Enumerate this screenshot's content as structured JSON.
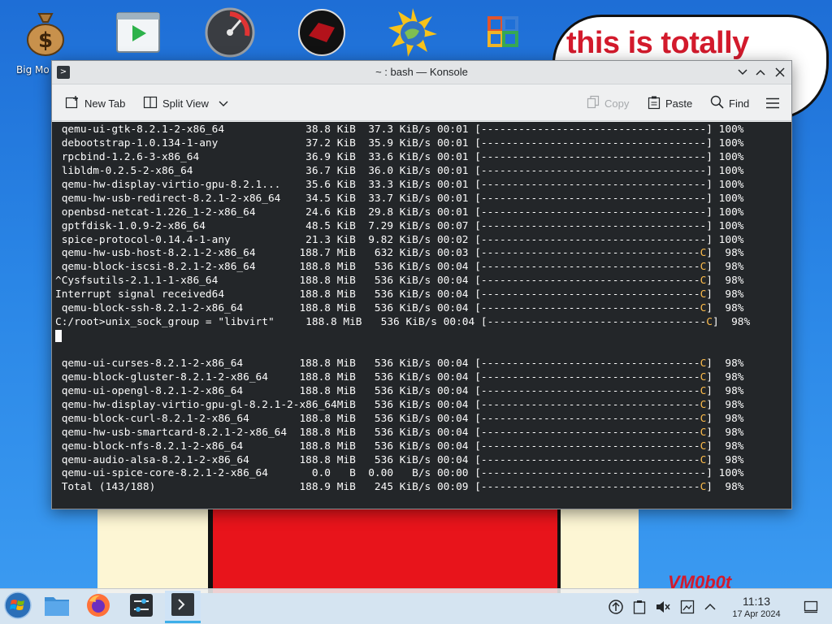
{
  "desktop": {
    "icons": [
      {
        "name": "money-bag-icon",
        "label": "Big Mo Delu"
      },
      {
        "name": "video-player-icon",
        "label": ""
      },
      {
        "name": "speedometer-icon",
        "label": ""
      },
      {
        "name": "red-sphere-icon",
        "label": ""
      },
      {
        "name": "globe-sun-icon",
        "label": ""
      },
      {
        "name": "office-icon",
        "label": ""
      }
    ],
    "wallpaper_text": "this is totally",
    "wallpaper_signature": "VM0b0t"
  },
  "window": {
    "title": "~ : bash — Konsole",
    "toolbar": {
      "new_tab": "New Tab",
      "split_view": "Split View",
      "copy": "Copy",
      "paste": "Paste",
      "find": "Find"
    }
  },
  "terminal": {
    "lines": [
      {
        "t": " qemu-ui-gtk-8.2.1-2-x86_64             38.8 KiB  37.3 KiB/s 00:01 [------------------------------------] 100%"
      },
      {
        "t": " debootstrap-1.0.134-1-any              37.2 KiB  35.9 KiB/s 00:01 [------------------------------------] 100%"
      },
      {
        "t": " rpcbind-1.2.6-3-x86_64                 36.9 KiB  33.6 KiB/s 00:01 [------------------------------------] 100%"
      },
      {
        "t": " libldm-0.2.5-2-x86_64                  36.7 KiB  36.0 KiB/s 00:01 [------------------------------------] 100%"
      },
      {
        "t": " qemu-hw-display-virtio-gpu-8.2.1...    35.6 KiB  33.3 KiB/s 00:01 [------------------------------------] 100%"
      },
      {
        "t": " qemu-hw-usb-redirect-8.2.1-2-x86_64    34.5 KiB  33.7 KiB/s 00:01 [------------------------------------] 100%"
      },
      {
        "t": " openbsd-netcat-1.226_1-2-x86_64        24.6 KiB  29.8 KiB/s 00:01 [------------------------------------] 100%"
      },
      {
        "t": " gptfdisk-1.0.9-2-x86_64                48.5 KiB  7.29 KiB/s 00:07 [------------------------------------] 100%"
      },
      {
        "t": " spice-protocol-0.14.4-1-any            21.3 KiB  9.82 KiB/s 00:02 [------------------------------------] 100%"
      },
      {
        "t": " qemu-hw-usb-host-8.2.1-2-x86_64       188.7 MiB   632 KiB/s 00:03 [-----------------------------------",
        "c": "C",
        "e": "]  98%"
      },
      {
        "t": " qemu-block-iscsi-8.2.1-2-x86_64       188.8 MiB   536 KiB/s 00:04 [-----------------------------------",
        "c": "C",
        "e": "]  98%"
      },
      {
        "t": "^Cysfsutils-2.1.1-1-x86_64             188.8 MiB   536 KiB/s 00:04 [-----------------------------------",
        "c": "C",
        "e": "]  98%"
      },
      {
        "t": "Interrupt signal received64            188.8 MiB   536 KiB/s 00:04 [-----------------------------------",
        "c": "C",
        "e": "]  98%"
      },
      {
        "t": " qemu-block-ssh-8.2.1-2-x86_64         188.8 MiB   536 KiB/s 00:04 [-----------------------------------",
        "c": "C",
        "e": "]  98%"
      },
      {
        "t": "C:/root>unix_sock_group = \"libvirt\"     188.8 MiB   536 KiB/s 00:04 [-----------------------------------",
        "c": "C",
        "e": "]  98%"
      },
      {
        "t": "",
        "cursor": true
      },
      {
        "t": ""
      },
      {
        "t": " qemu-ui-curses-8.2.1-2-x86_64         188.8 MiB   536 KiB/s 00:04 [-----------------------------------",
        "c": "C",
        "e": "]  98%"
      },
      {
        "t": " qemu-block-gluster-8.2.1-2-x86_64     188.8 MiB   536 KiB/s 00:04 [-----------------------------------",
        "c": "C",
        "e": "]  98%"
      },
      {
        "t": " qemu-ui-opengl-8.2.1-2-x86_64         188.8 MiB   536 KiB/s 00:04 [-----------------------------------",
        "c": "C",
        "e": "]  98%"
      },
      {
        "t": " qemu-hw-display-virtio-gpu-gl-8.2.1-2-x86_64MiB   536 KiB/s 00:04 [-----------------------------------",
        "c": "C",
        "e": "]  98%"
      },
      {
        "t": " qemu-block-curl-8.2.1-2-x86_64        188.8 MiB   536 KiB/s 00:04 [-----------------------------------",
        "c": "C",
        "e": "]  98%"
      },
      {
        "t": " qemu-hw-usb-smartcard-8.2.1-2-x86_64  188.8 MiB   536 KiB/s 00:04 [-----------------------------------",
        "c": "C",
        "e": "]  98%"
      },
      {
        "t": " qemu-block-nfs-8.2.1-2-x86_64         188.8 MiB   536 KiB/s 00:04 [-----------------------------------",
        "c": "C",
        "e": "]  98%"
      },
      {
        "t": " qemu-audio-alsa-8.2.1-2-x86_64        188.8 MiB   536 KiB/s 00:04 [-----------------------------------",
        "c": "C",
        "e": "]  98%"
      },
      {
        "t": " qemu-ui-spice-core-8.2.1-2-x86_64       0.0   B  0.00   B/s 00:00 [------------------------------------] 100%"
      },
      {
        "t": " Total (143/188)                       188.9 MiB   245 KiB/s 00:09 [-----------------------------------",
        "c": "C",
        "e": "]  98%"
      }
    ]
  },
  "taskbar": {
    "apps": [
      {
        "name": "start-menu-button"
      },
      {
        "name": "file-manager-taskbar-button"
      },
      {
        "name": "firefox-taskbar-button"
      },
      {
        "name": "system-settings-taskbar-button"
      },
      {
        "name": "konsole-taskbar-button",
        "active": true
      }
    ],
    "clock": {
      "time": "11:13",
      "date": "17 Apr 2024"
    }
  },
  "colors": {
    "terminal_bg": "#232629",
    "terminal_fg": "#fcfcfc",
    "progress_cursor": "#fdbc4b",
    "accent": "#3daee9"
  }
}
